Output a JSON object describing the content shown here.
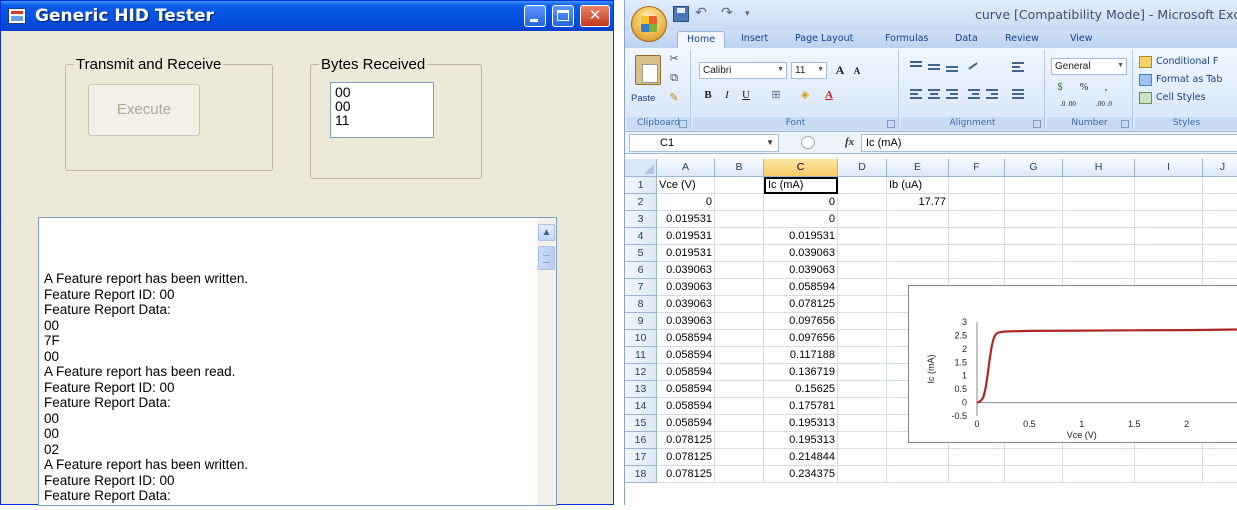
{
  "hid": {
    "title": "Generic HID Tester",
    "title_buttons": {
      "minimize": "_",
      "maximize": "□",
      "close": "✕"
    },
    "transmit_group": "Transmit and Receive",
    "execute_label": "Execute",
    "bytes_group": "Bytes Received",
    "bytes": [
      "00",
      "00",
      "11"
    ],
    "log": [
      "A Feature report has been written.",
      " Feature Report ID: 00",
      " Feature Report Data:",
      "00",
      "7F",
      "00",
      "A Feature report has been read.",
      " Feature Report ID: 00",
      " Feature Report Data:",
      "00",
      "00",
      "02",
      "A Feature report has been written.",
      " Feature Report ID: 00",
      " Feature Report Data:"
    ],
    "scroll_up": "▲"
  },
  "excel": {
    "window_title": "curve  [Compatibility Mode] - Microsoft Excel",
    "qat": {
      "undo": "↶",
      "redo": "↷",
      "more": "▾"
    },
    "tabs": [
      "Home",
      "Insert",
      "Page Layout",
      "Formulas",
      "Data",
      "Review",
      "View"
    ],
    "ribbon": {
      "clipboard": {
        "label": "Clipboard",
        "paste": "Paste",
        "cut": "✂",
        "copy": "⧉",
        "painter": "✎"
      },
      "font": {
        "label": "Font",
        "name": "Calibri",
        "size": "11",
        "grow": "A",
        "shrink": "A",
        "bold": "B",
        "italic": "I",
        "underline": "U",
        "border": "⊞",
        "fill": "◈",
        "color": "A"
      },
      "alignment": {
        "label": "Alignment"
      },
      "number": {
        "label": "Number",
        "format": "General",
        "currency": "$",
        "percent": "%",
        "comma": ",",
        "inc": ".0 .00",
        "dec": ".00 .0"
      },
      "styles": {
        "label": "Styles",
        "conditional": "Conditional F",
        "format_table": "Format as Tab",
        "cell_styles": "Cell Styles"
      }
    },
    "name_box": "C1",
    "fx": "fx",
    "formula": "Ic (mA)",
    "columns": [
      "A",
      "B",
      "C",
      "D",
      "E",
      "F",
      "G",
      "H",
      "I",
      "J"
    ],
    "selected_column": "C",
    "rows": [
      {
        "n": "1",
        "A": "Vce (V)",
        "C": "Ic (mA)",
        "E": "Ib (uA)"
      },
      {
        "n": "2",
        "A": "0",
        "C": "0",
        "E": "17.77"
      },
      {
        "n": "3",
        "A": "0.019531",
        "C": "0"
      },
      {
        "n": "4",
        "A": "0.019531",
        "C": "0.019531"
      },
      {
        "n": "5",
        "A": "0.019531",
        "C": "0.039063"
      },
      {
        "n": "6",
        "A": "0.039063",
        "C": "0.039063"
      },
      {
        "n": "7",
        "A": "0.039063",
        "C": "0.058594"
      },
      {
        "n": "8",
        "A": "0.039063",
        "C": "0.078125"
      },
      {
        "n": "9",
        "A": "0.039063",
        "C": "0.097656"
      },
      {
        "n": "10",
        "A": "0.058594",
        "C": "0.097656"
      },
      {
        "n": "11",
        "A": "0.058594",
        "C": "0.117188"
      },
      {
        "n": "12",
        "A": "0.058594",
        "C": "0.136719"
      },
      {
        "n": "13",
        "A": "0.058594",
        "C": "0.15625"
      },
      {
        "n": "14",
        "A": "0.058594",
        "C": "0.175781"
      },
      {
        "n": "15",
        "A": "0.058594",
        "C": "0.195313"
      },
      {
        "n": "16",
        "A": "0.078125",
        "C": "0.195313"
      },
      {
        "n": "17",
        "A": "0.078125",
        "C": "0.214844"
      },
      {
        "n": "18",
        "A": "0.078125",
        "C": "0.234375"
      }
    ],
    "accent": "#b02626"
  },
  "chart_data": {
    "type": "line",
    "title": "",
    "xlabel": "Vce (V)",
    "ylabel": "Ic (mA)",
    "xlim": [
      0,
      2.5
    ],
    "ylim": [
      -0.5,
      3
    ],
    "x_ticks": [
      "0",
      "0.5",
      "1",
      "1.5",
      "2"
    ],
    "y_ticks": [
      "-0.5",
      "0",
      "0.5",
      "1",
      "1.5",
      "2",
      "2.5",
      "3"
    ],
    "series": [
      {
        "x": [
          0,
          0.02,
          0.04,
          0.06,
          0.08,
          0.1,
          0.12,
          0.14,
          0.16,
          0.18,
          0.2,
          0.25,
          0.3,
          0.5,
          1.0,
          1.5,
          2.0,
          2.5
        ],
        "y": [
          0,
          0.02,
          0.08,
          0.2,
          0.5,
          1.0,
          1.6,
          2.1,
          2.4,
          2.55,
          2.6,
          2.64,
          2.65,
          2.67,
          2.68,
          2.69,
          2.7,
          2.72
        ],
        "color": "#b02626"
      }
    ]
  }
}
